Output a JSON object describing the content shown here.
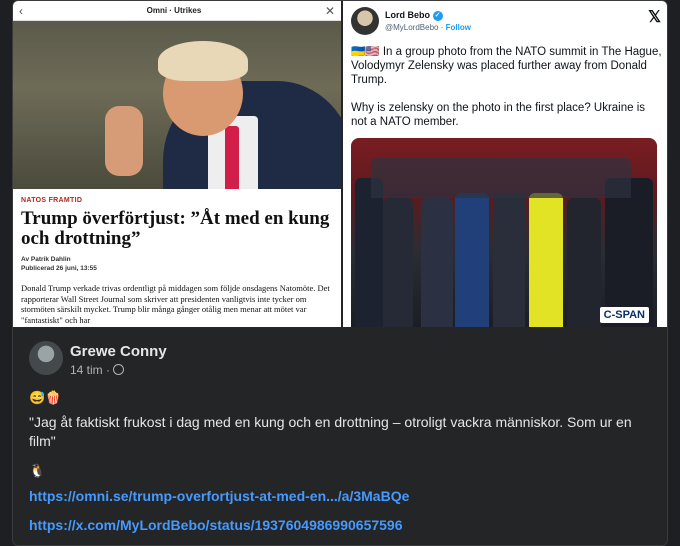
{
  "omni": {
    "source": "Omni · Utrikes",
    "kicker": "NATOS FRAMTID",
    "headline": "Trump överförtjust: ”Åt med en kung och drottning”",
    "byline": "Av Patrik Dahlin",
    "published": "Publicerad 26 juni, 13:55",
    "body": "Donald Trump verkade trivas ordentligt på middagen som följde onsdagens Natomöte. Det rapporterar Wall Street Journal som skriver att presidenten vanligtvis inte tycker om stormöten särskilt mycket. Trump blir många gånger otålig men menar att mötet var \"fantastiskt\" och har"
  },
  "tweet": {
    "name": "Lord Bebo",
    "handle": "@MyLordBebo",
    "follow": "Follow",
    "flags": "🇺🇦🇺🇸",
    "text1": "In a group photo from the NATO summit in The Hague, Volodymyr Zelensky was placed further away from Donald Trump.",
    "text2": "Why is zelensky on the photo in the first place? Ukraine is not a NATO member.",
    "watermark": "C-SPAN"
  },
  "post": {
    "author": "Grewe Conny",
    "time": "14 tim",
    "separator": "·",
    "line1": "😅🍿",
    "quote": "\"Jag åt faktiskt frukost i dag med en kung och en drottning – otroligt vackra människor. Som ur en film\"",
    "line3": "🐧",
    "link1": "https://omni.se/trump-overfortjust-at-med-en.../a/3MaBQe",
    "link2": "https://x.com/MyLordBebo/status/1937604986990657596"
  }
}
